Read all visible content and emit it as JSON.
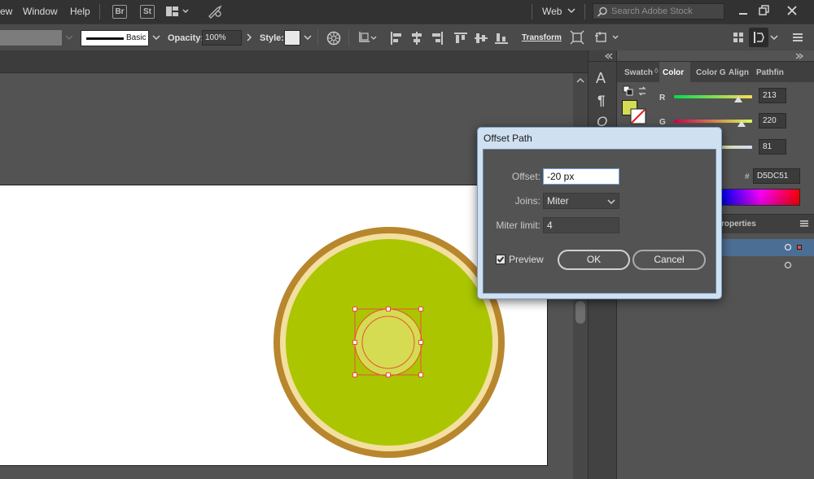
{
  "menu": {
    "items": [
      "ew",
      "Window",
      "Help"
    ],
    "bridge_label": "Br",
    "stock_label": "St",
    "workspace": "Web",
    "search_placeholder": "Search Adobe Stock"
  },
  "control_bar": {
    "stroke_style": "Basic",
    "opacity_label": "Opacity:",
    "opacity_value": "100%",
    "style_label": "Style:",
    "transform_label": "Transform"
  },
  "tools": {
    "type_tool": "A",
    "paragraph_tool": "¶",
    "glyph_tool": "O"
  },
  "panels": {
    "tabs": [
      "Swatch",
      "Color",
      "Color G",
      "Align",
      "Pathfin"
    ],
    "color": {
      "r_label": "R",
      "g_label": "G",
      "r_value": "213",
      "g_value": "220",
      "b_value": "81",
      "hex_label": "#",
      "hex_value": "D5DC51",
      "fill_color": "#d5dc51"
    },
    "properties_tab": "roperties"
  },
  "dialog": {
    "title": "Offset Path",
    "offset_label": "Offset:",
    "offset_value": "-20 px",
    "joins_label": "Joins:",
    "joins_value": "Miter",
    "miter_label": "Miter limit:",
    "miter_value": "4",
    "preview_label": "Preview",
    "preview_checked": true,
    "ok_label": "OK",
    "cancel_label": "Cancel"
  },
  "artwork": {
    "outer_ring_color": "#b8862c",
    "inner_ring_color": "#f3dfa0",
    "main_fill_color": "#abc601",
    "small_fill_color": "#d5dc51",
    "selection_color": "#e8503a"
  }
}
